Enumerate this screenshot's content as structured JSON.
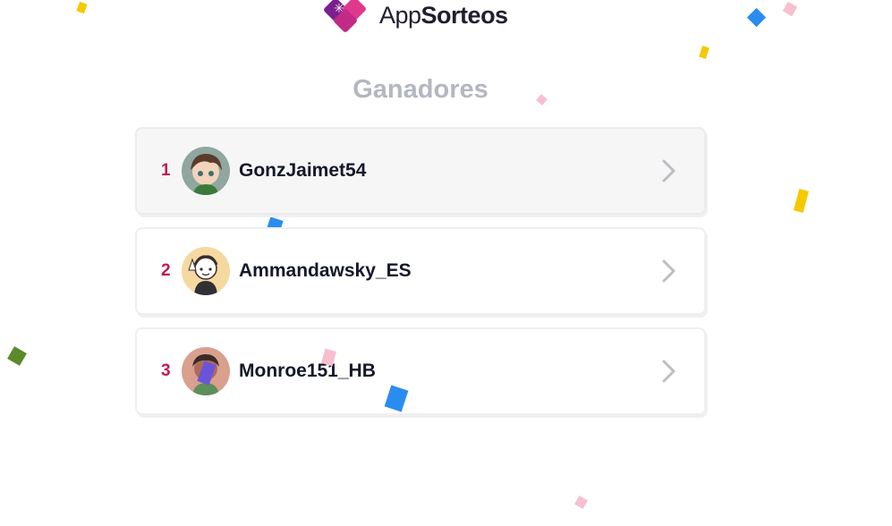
{
  "brand": {
    "name_light": "App",
    "name_bold": "Sorteos"
  },
  "page": {
    "title": "Ganadores"
  },
  "winners": [
    {
      "rank": "1",
      "name": "GonzJaimet54"
    },
    {
      "rank": "2",
      "name": "Ammandawsky_ES"
    },
    {
      "rank": "3",
      "name": "Monroe151_HB"
    }
  ],
  "colors": {
    "rank": "#c2185b",
    "title": "#b4b7c0",
    "name": "#15172b",
    "brand_purple": "#7a1f8e",
    "brand_pink": "#e0398c"
  },
  "icons": {
    "chevron": "chevron-right-icon",
    "logo": "appsorteos-logo-icon"
  }
}
